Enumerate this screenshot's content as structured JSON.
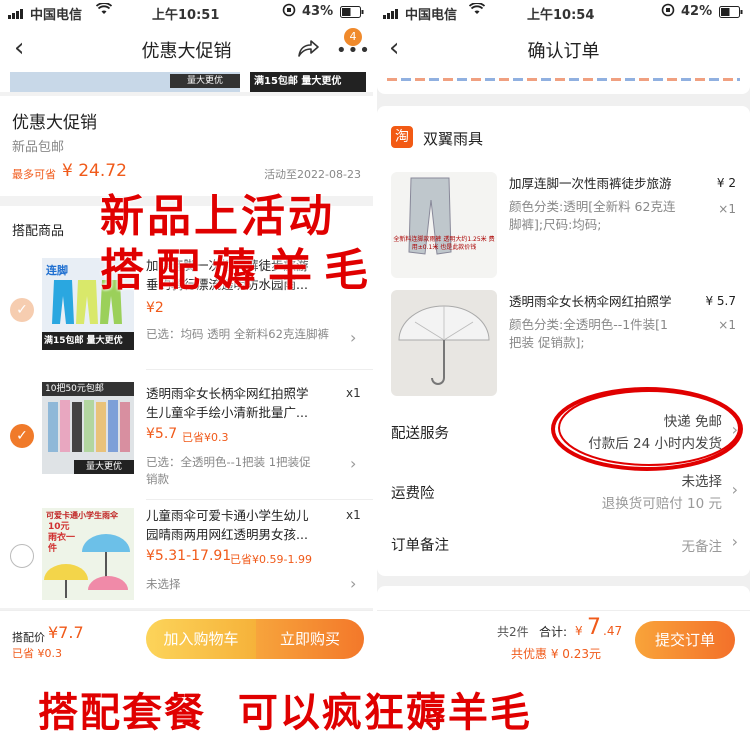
{
  "left": {
    "status": {
      "carrier": "中国电信",
      "time": "上午10:51",
      "battery": "43%"
    },
    "nav": {
      "title": "优惠大促销",
      "badge": "4"
    },
    "banner": {
      "text_1": "量大更优",
      "text_2": "满15包邮 量大更优"
    },
    "promo": {
      "title": "优惠大促销",
      "subtitle": "新品包邮",
      "save_label": "最多可省",
      "save_amount": "¥ 24.72",
      "deadline": "活动至2022-08-23"
    },
    "section_title": "搭配商品",
    "products": [
      {
        "title": "加厚连脚一次性雨裤徒步旅游垂钓骑行漂流透明防水园雨...",
        "price": "¥2",
        "sku": "已选：均码 透明 全新料62克连脚裤",
        "thumb_text_top": "连脚",
        "thumb_text_bottom": "满15包邮 量大更优"
      },
      {
        "title": "透明雨伞女长柄伞网红拍照学生儿童伞手绘小清新批量广...",
        "price": "¥5.7",
        "saved": "已省¥0.3",
        "sku": "已选：全透明色--1把装 1把装促销款",
        "qty": "x1",
        "thumb_text_top": "10把50元包邮",
        "thumb_text_bottom": "量大更优"
      },
      {
        "title": "儿童雨伞可爱卡通小学生幼儿园晴雨两用网红透明男女孩...",
        "price": "¥5.31-17.91",
        "saved": "已省¥0.59-1.99",
        "sku": "未选择",
        "qty": "x1",
        "thumb_text_top": "可爱卡通小学生雨伞",
        "thumb_text_mid": "10元 雨衣一件"
      }
    ],
    "bottom": {
      "price_label": "搭配价",
      "price": "¥7.7",
      "saved": "已省 ¥0.3",
      "cart_label": "加入购物车",
      "buy_label": "立即购买"
    }
  },
  "right": {
    "status": {
      "carrier": "中国电信",
      "time": "上午10:54",
      "battery": "42%"
    },
    "nav": {
      "title": "确认订单"
    },
    "shop": {
      "icon_text": "淘",
      "name": "双翼雨具"
    },
    "items": [
      {
        "title": "加厚连脚一次性雨裤徒步旅游",
        "price": "¥ 2",
        "sku": "颜色分类:透明[全新料 62克连脚裤];尺码:均码;",
        "qty": "×1",
        "thumb_caption": "全新料连脚款雨裤 透明大约1.25米 费用±0.1米 也是此款价钱"
      },
      {
        "title": "透明雨伞女长柄伞网红拍照学",
        "price": "¥ 5.7",
        "sku": "颜色分类:全透明色--1件装[1把装 促销款];",
        "qty": "×1"
      }
    ],
    "delivery": {
      "label": "配送服务",
      "line1": "快递 免邮",
      "line2": "付款后 24 小时内发货"
    },
    "insurance": {
      "label": "运费险",
      "line1": "未选择",
      "line2": "退换货可赔付 10 元"
    },
    "remarks": {
      "label": "订单备注",
      "value": "无备注"
    },
    "bottom": {
      "count": "共2件",
      "total_label": "合计:",
      "total_currency": "¥",
      "total_int": "7",
      "total_dec": ".47",
      "discount": "共优惠 ¥ 0.23元",
      "submit_label": "提交订单"
    }
  },
  "overlay": {
    "line1": "新品上活动",
    "line2": "搭配薅羊毛",
    "bottom": "搭配套餐  可以疯狂薅羊毛"
  },
  "colors": {
    "accent": "#f07a2a",
    "price": "#f05a1a",
    "overlay_red": "#e00000",
    "submit": "#f57a2c"
  },
  "icons": [
    "back-arrow-icon",
    "share-icon",
    "more-icon",
    "wifi-icon",
    "signal-icon",
    "battery-icon",
    "orientation-lock-icon",
    "chevron-right-icon",
    "check-icon",
    "taobao-icon"
  ]
}
